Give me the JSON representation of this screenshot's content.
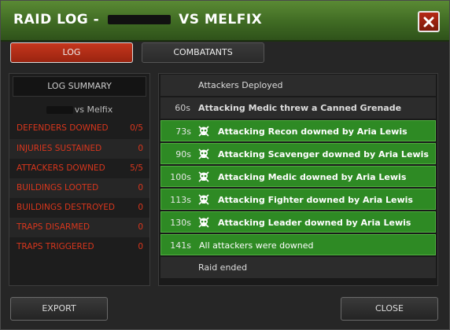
{
  "window": {
    "title_prefix": "RAID LOG -",
    "title_suffix": "VS MELFIX",
    "close_icon": "close-icon"
  },
  "tabs": [
    {
      "label": "LOG",
      "active": true
    },
    {
      "label": "COMBATANTS",
      "active": false
    }
  ],
  "summary": {
    "title": "LOG SUMMARY",
    "subtitle_suffix": "vs Melfix",
    "stats": [
      {
        "label": "DEFENDERS DOWNED",
        "value": "0/5"
      },
      {
        "label": "INJURIES SUSTAINED",
        "value": "0"
      },
      {
        "label": "ATTACKERS DOWNED",
        "value": "5/5"
      },
      {
        "label": "BUILDINGS LOOTED",
        "value": "0"
      },
      {
        "label": "BUILDINGS DESTROYED",
        "value": "0"
      },
      {
        "label": "TRAPS DISARMED",
        "value": "0"
      },
      {
        "label": "TRAPS TRIGGERED",
        "value": "0"
      }
    ],
    "stat_color": "#d8361d"
  },
  "log": {
    "entries": [
      {
        "time": "",
        "text": "Attackers Deployed",
        "style": "plain",
        "icon": ""
      },
      {
        "time": "60s",
        "text": "Attacking Medic threw a Canned Grenade",
        "style": "plain-bold",
        "icon": ""
      },
      {
        "time": "73s",
        "text": "Attacking Recon downed by Aria Lewis",
        "style": "green",
        "icon": "skull-icon"
      },
      {
        "time": "90s",
        "text": "Attacking Scavenger downed by Aria Lewis",
        "style": "green",
        "icon": "skull-icon"
      },
      {
        "time": "100s",
        "text": "Attacking Medic downed by Aria Lewis",
        "style": "green",
        "icon": "skull-icon"
      },
      {
        "time": "113s",
        "text": "Attacking Fighter downed by Aria Lewis",
        "style": "green",
        "icon": "skull-icon"
      },
      {
        "time": "130s",
        "text": "Attacking Leader downed by Aria Lewis",
        "style": "green",
        "icon": "skull-icon"
      },
      {
        "time": "141s",
        "text": "All attackers were downed",
        "style": "green-normal",
        "icon": ""
      },
      {
        "time": "",
        "text": "Raid ended",
        "style": "plain",
        "icon": ""
      }
    ],
    "highlight_color": "#2e8a24"
  },
  "buttons": {
    "export_label": "EXPORT",
    "close_label": "CLOSE"
  }
}
